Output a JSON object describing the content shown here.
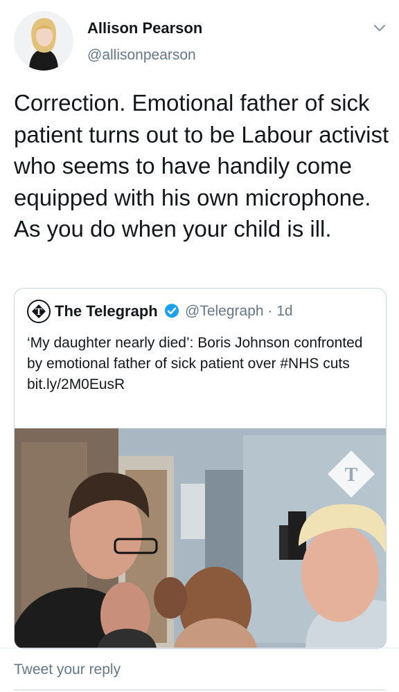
{
  "author": {
    "name": "Allison Pearson",
    "handle": "@allisonpearson"
  },
  "tweet": {
    "text": "Correction. Emotional father of sick patient turns out to be Labour activist who seems to have handily come equipped with his own microphone. As you do when your child is ill."
  },
  "quoted": {
    "name": "The Telegraph",
    "handle": "@Telegraph",
    "time": "1d",
    "text": "‘My daughter nearly died’: Boris Johnson confronted by emotional father of sick patient over #NHS cuts",
    "link": "bit.ly/2M0EusR",
    "verified": true,
    "logo_icon": "telegraph-logo-icon"
  },
  "reply": {
    "placeholder": "Tweet your reply"
  },
  "colors": {
    "text": "#14171a",
    "secondary": "#657786",
    "verified": "#1da1f2",
    "border": "#ccd6dd"
  }
}
